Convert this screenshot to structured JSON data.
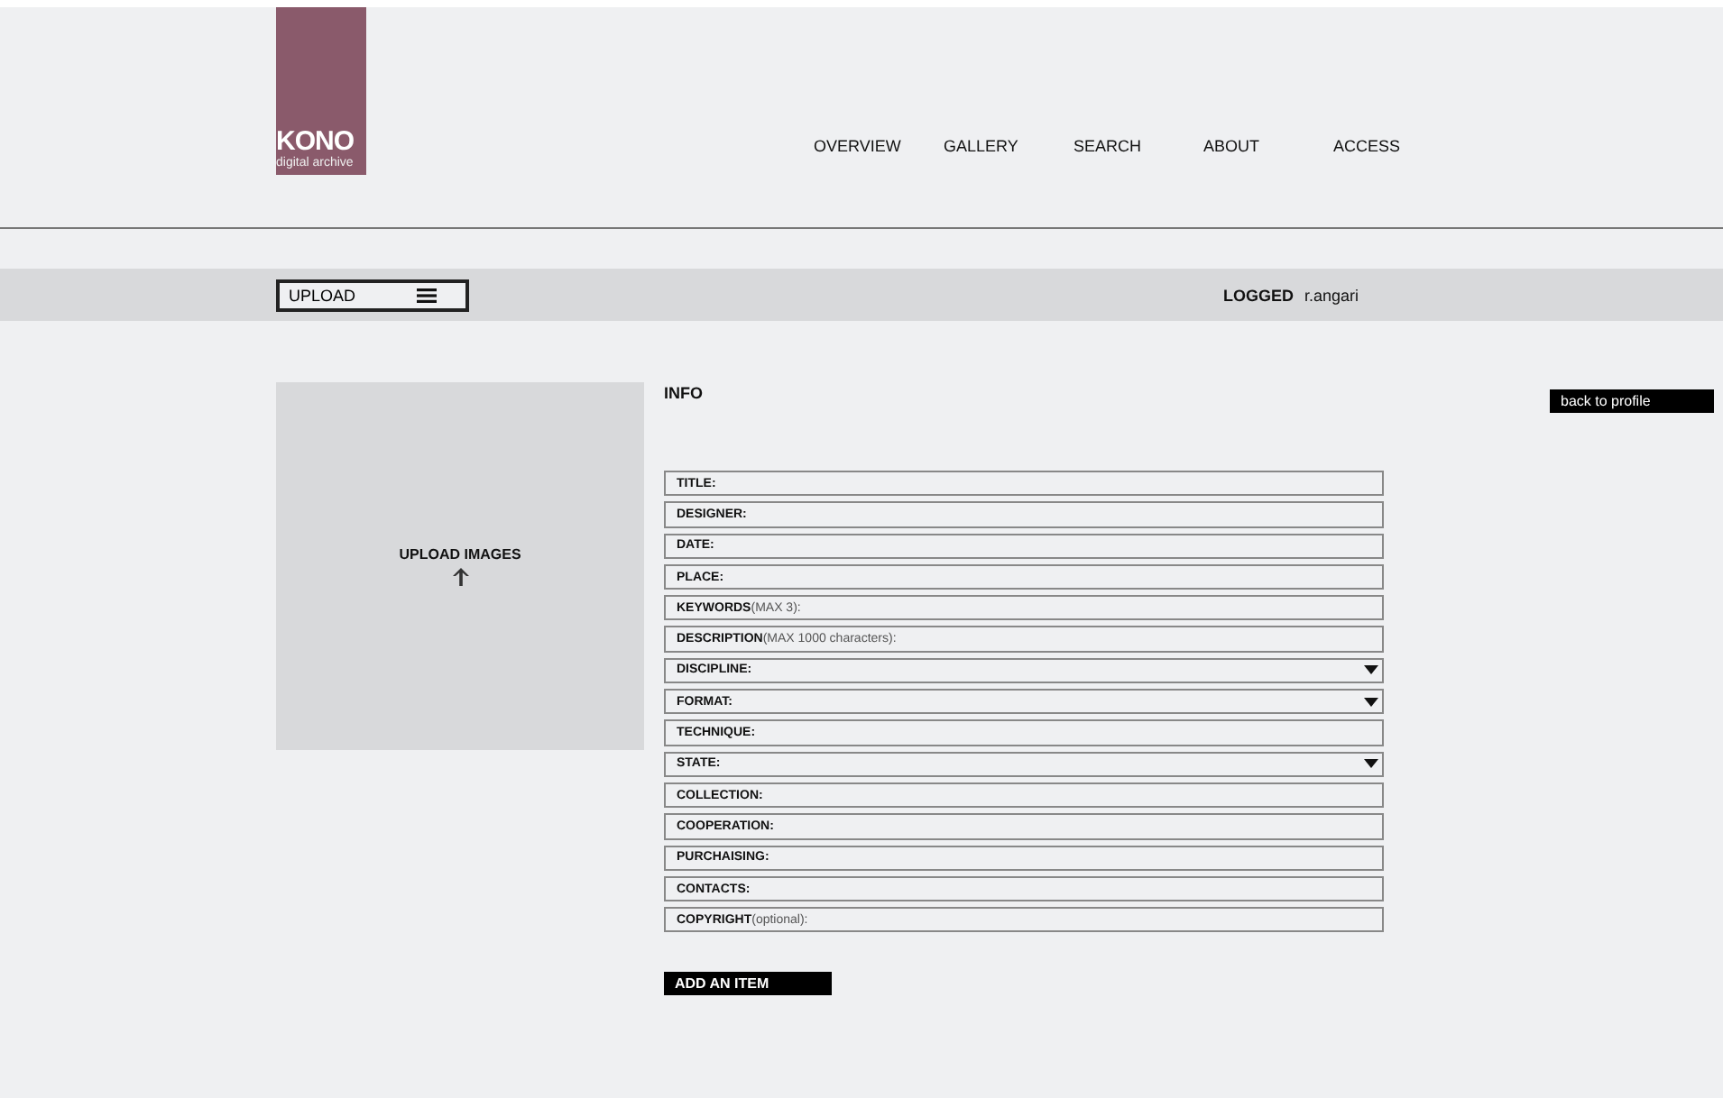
{
  "logo": {
    "title": "KONO",
    "subtitle": "digital archive"
  },
  "nav": [
    "OVERVIEW",
    "GALLERY",
    "SEARCH",
    "ABOUT",
    "ACCESS"
  ],
  "toolbar": {
    "menu_label": "UPLOAD",
    "logged_label": "LOGGED",
    "user": "r.angari"
  },
  "upload": {
    "label": "UPLOAD IMAGES"
  },
  "info": {
    "title": "INFO",
    "back_button": "back to profile",
    "fields": [
      {
        "label": "TITLE:",
        "kind": "text"
      },
      {
        "label": "DESIGNER:",
        "kind": "text"
      },
      {
        "label": "DATE:",
        "kind": "text"
      },
      {
        "label": "PLACE:",
        "kind": "text"
      },
      {
        "label": "KEYWORDS",
        "note": "(MAX 3):",
        "kind": "text"
      },
      {
        "label": "DESCRIPTION",
        "note": "(MAX 1000 characters):",
        "kind": "text"
      },
      {
        "label": "DISCIPLINE:",
        "kind": "select"
      },
      {
        "label": "FORMAT:",
        "kind": "select"
      },
      {
        "label": "TECHNIQUE:",
        "kind": "text"
      },
      {
        "label": "STATE:",
        "kind": "select"
      },
      {
        "label": "COLLECTION:",
        "kind": "text"
      },
      {
        "label": "COOPERATION:",
        "kind": "text"
      },
      {
        "label": "PURCHAISING:",
        "kind": "text"
      },
      {
        "label": "CONTACTS:",
        "kind": "text"
      },
      {
        "label": "COPYRIGHT",
        "note": "(optional):",
        "kind": "text"
      }
    ],
    "add_button": "ADD AN ITEM"
  }
}
